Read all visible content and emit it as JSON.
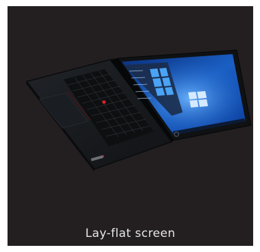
{
  "caption": "Lay-flat screen",
  "colors": {
    "background": "#231f20",
    "laptop_body": "#16181b",
    "screen_blue": "#1a5fc4",
    "trackpoint": "#d9202a",
    "caption_text": "#e8e8e8"
  },
  "icons": [
    "laptop-image",
    "windows-logo-icon",
    "trackpoint-icon",
    "thinkpad-logo-icon"
  ]
}
